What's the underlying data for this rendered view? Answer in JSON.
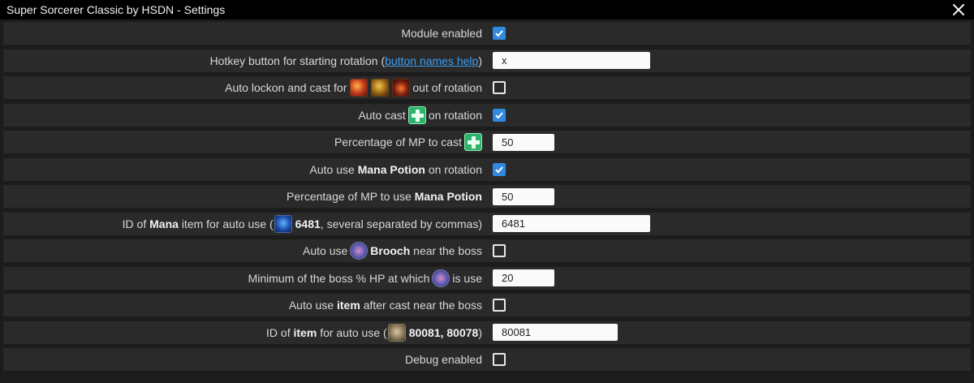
{
  "window": {
    "title": "Super Sorcerer Classic by HSDN - Settings"
  },
  "rows": {
    "module_enabled": {
      "label": "Module enabled",
      "checked": true
    },
    "hotkey": {
      "pre": "Hotkey button for starting rotation (",
      "link": "button names help",
      "post": ")",
      "value": "x"
    },
    "auto_lockon": {
      "pre": "Auto lockon and cast for",
      "post": "out of rotation",
      "checked": false
    },
    "auto_cast": {
      "pre": "Auto cast",
      "post": "on rotation",
      "checked": true
    },
    "mp_cast": {
      "pre": "Percentage of MP to cast",
      "value": "50"
    },
    "mana_potion": {
      "pre": "Auto use",
      "bold": "Mana Potion",
      "post": "on rotation",
      "checked": true
    },
    "mp_potion": {
      "pre": "Percentage of MP to use",
      "bold": "Mana Potion",
      "value": "50"
    },
    "mana_item_id": {
      "pre": "ID of",
      "bold": "Mana",
      "mid": "item for auto use (",
      "bold2": "6481",
      "post": ", several separated by commas)",
      "value": "6481"
    },
    "brooch": {
      "pre": "Auto use",
      "bold": "Brooch",
      "post": "near the boss",
      "checked": false
    },
    "boss_hp": {
      "pre": "Minimum of the boss % HP at which",
      "post": "is use",
      "value": "20"
    },
    "item_after_cast": {
      "pre": "Auto use",
      "bold": "item",
      "post": "after cast near the boss",
      "checked": false
    },
    "item_id": {
      "pre": "ID of",
      "bold": "item",
      "mid": "for auto use (",
      "bold2": "80081, 80078",
      "post": ")",
      "value": "80081"
    },
    "debug": {
      "label": "Debug enabled",
      "checked": false
    }
  },
  "icons": {
    "close": "close-icon",
    "skill_fire": "fire-skill-icon",
    "skill_claw": "claw-skill-icon",
    "skill_lava": "lava-skill-icon",
    "heal": "heal-cross-icon",
    "mana_potion": "mana-potion-icon",
    "brooch": "brooch-icon",
    "item": "item-icon"
  },
  "colors": {
    "accent": "#2f8ae0",
    "link": "#3d9cf0",
    "row_bg": "#2a2a2a",
    "title_bg": "#000000"
  }
}
